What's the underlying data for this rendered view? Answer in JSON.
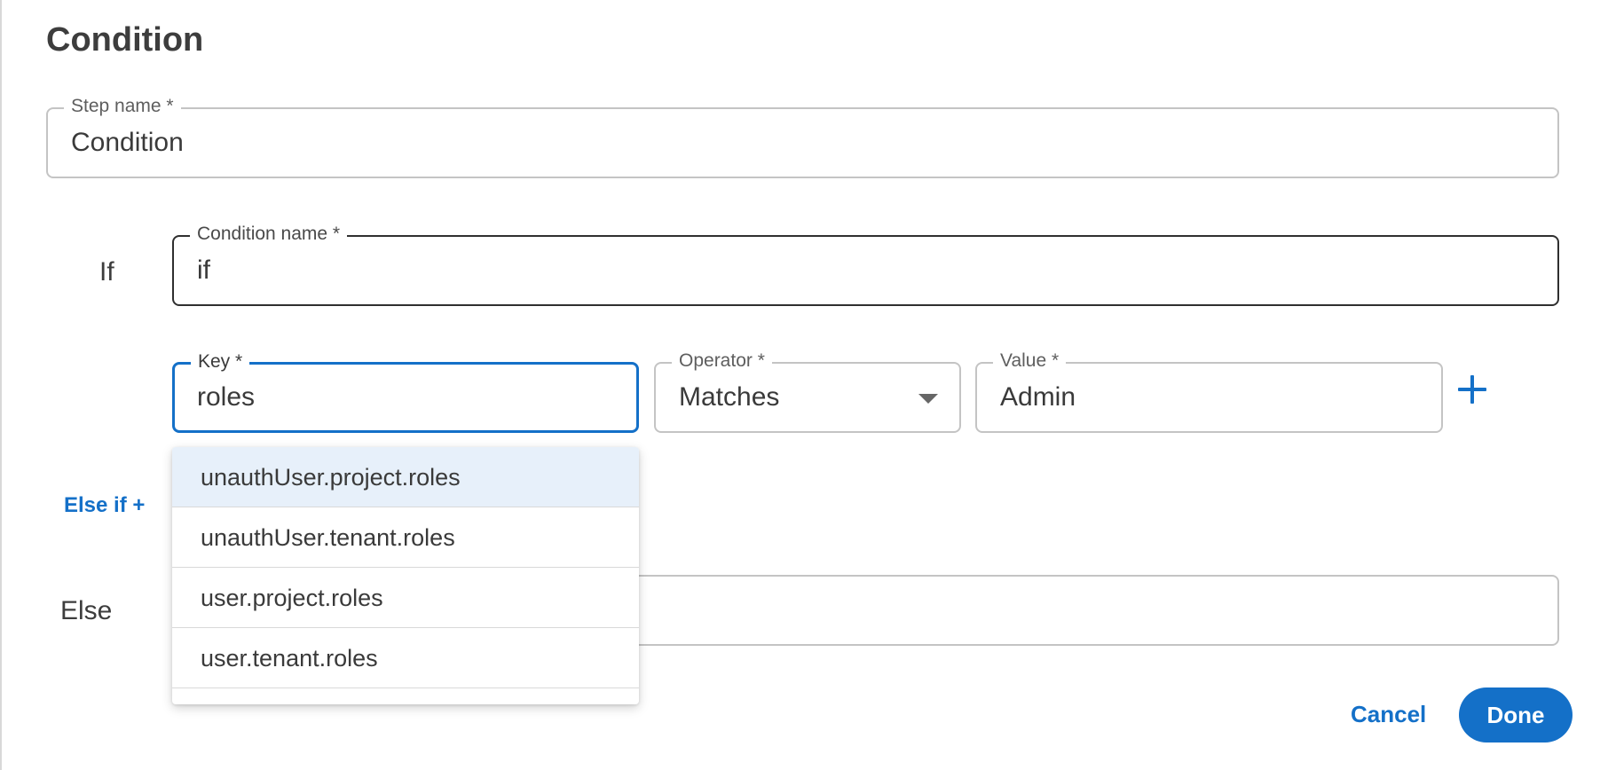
{
  "dialog": {
    "title": "Condition"
  },
  "step_name": {
    "label": "Step name *",
    "value": "Condition"
  },
  "if_section": {
    "label": "If",
    "condition_name": {
      "label": "Condition name *",
      "value": "if"
    },
    "key": {
      "label": "Key *",
      "value": "roles"
    },
    "operator": {
      "label": "Operator *",
      "value": "Matches"
    },
    "value": {
      "label": "Value *",
      "value": "Admin"
    },
    "add_icon": "plus-icon"
  },
  "else_if": {
    "label": "Else if +"
  },
  "else_section": {
    "label": "Else"
  },
  "key_suggestions": {
    "options": [
      "unauthUser.project.roles",
      "unauthUser.tenant.roles",
      "user.project.roles",
      "user.tenant.roles"
    ],
    "highlighted_index": 0
  },
  "footer": {
    "cancel_label": "Cancel",
    "done_label": "Done"
  },
  "colors": {
    "accent": "#1470c8",
    "highlight": "#e7f0fa"
  }
}
